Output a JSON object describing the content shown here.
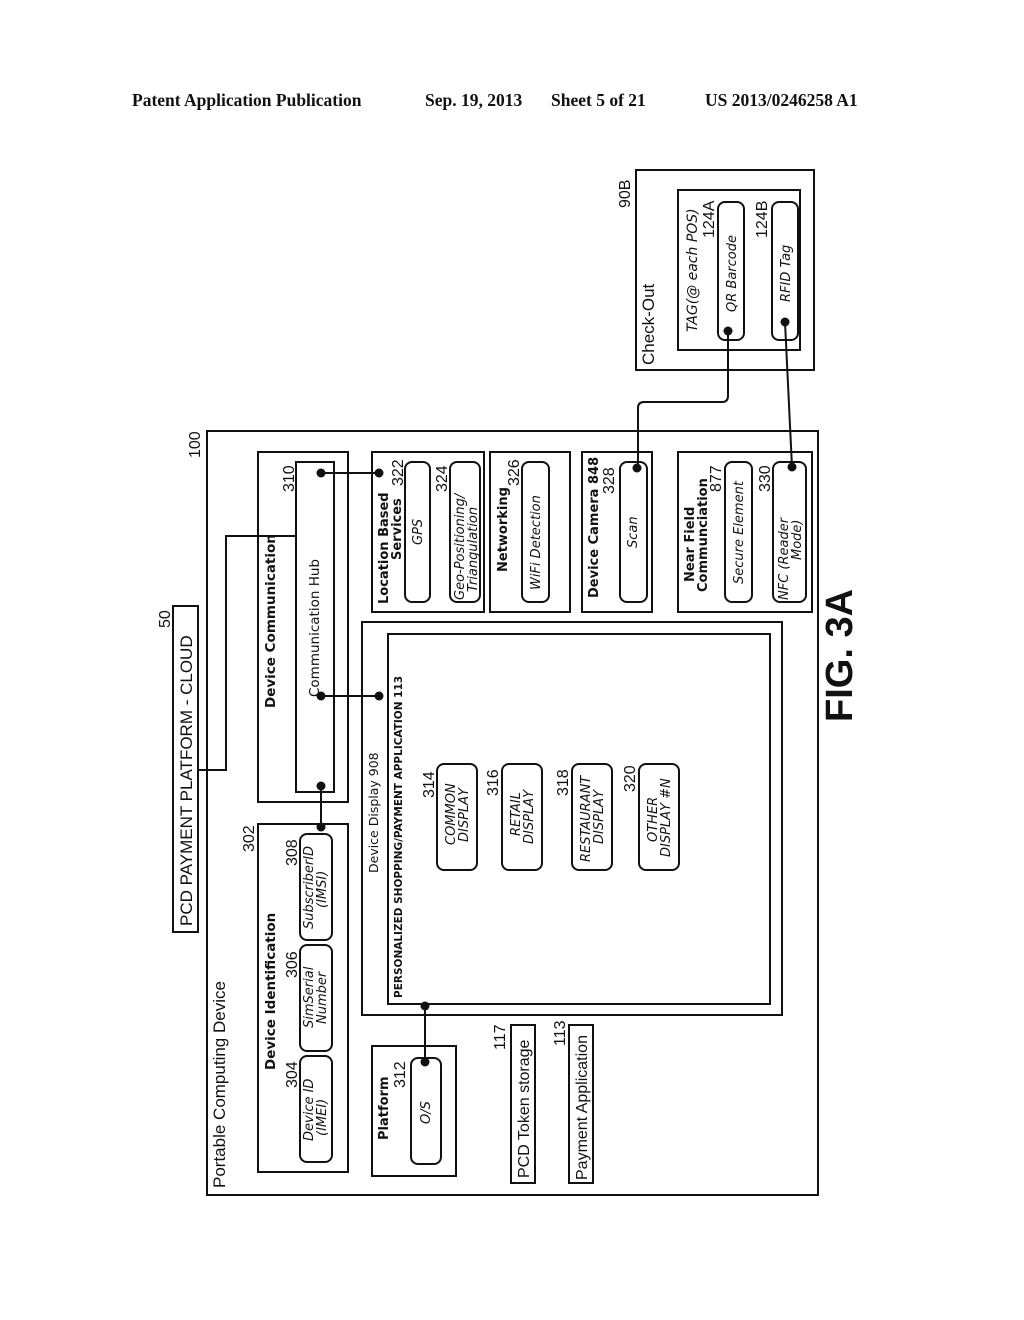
{
  "header": {
    "publication": "Patent Application Publication",
    "date": "Sep. 19, 2013",
    "sheet": "Sheet 5 of 21",
    "number": "US 2013/0246258 A1"
  },
  "figure_label": "FIG. 3A",
  "cloud": {
    "label": "PCD PAYMENT PLATFORM - CLOUD",
    "ref": "50"
  },
  "device": {
    "label": "Portable Computing Device",
    "ref": "100",
    "communication": {
      "label": "Device Communication",
      "hub": {
        "label": "Communication Hub",
        "ref": "310"
      }
    },
    "identification": {
      "label": "Device Identification",
      "ref": "302",
      "items": [
        {
          "line1": "Device ID",
          "line2": "(IMEI)",
          "ref": "304"
        },
        {
          "line1": "SimSerial",
          "line2": "Number",
          "ref": "306"
        },
        {
          "line1": "SubscriberID",
          "line2": "(IMSI)",
          "ref": "308"
        }
      ]
    },
    "display": {
      "label": "Device Display 908",
      "app_label": "PERSONALIZED SHOPPING/PAYMENT APPLICATION 113",
      "items": [
        {
          "line1": "COMMON",
          "line2": "DISPLAY",
          "ref": "314"
        },
        {
          "line1": "RETAIL",
          "line2": "DISPLAY",
          "ref": "316"
        },
        {
          "line1": "RESTAURANT",
          "line2": "DISPLAY",
          "ref": "318"
        },
        {
          "line1": "OTHER",
          "line2": "DISPLAY #N",
          "ref": "320"
        }
      ]
    },
    "location": {
      "label_line1": "Location Based",
      "label_line2": "Services",
      "gps": {
        "label": "GPS",
        "ref": "322"
      },
      "geo": {
        "line1": "Geo-Positioning/",
        "line2": "Triangulation",
        "ref": "324"
      }
    },
    "networking": {
      "label": "Networking",
      "item": "WiFi Detection",
      "ref": "326"
    },
    "camera": {
      "label": "Device Camera 848",
      "item": "Scan",
      "ref": "328"
    },
    "nfc": {
      "label_line1": "Near Field",
      "label_line2": "Communciation",
      "secure": {
        "label": "Secure Element",
        "ref": "877"
      },
      "reader": {
        "line1": "NFC (Reader",
        "line2": "Mode)",
        "ref": "330"
      }
    },
    "platform": {
      "label": "Platform",
      "item": "O/S",
      "ref": "312"
    },
    "token_storage": {
      "label": "PCD Token storage",
      "ref": "117"
    },
    "payment_app": {
      "label": "Payment Application",
      "ref": "113"
    }
  },
  "checkout": {
    "label": "Check-Out",
    "ref": "90B",
    "tag_label": "TAG(@ each POS)",
    "qr": {
      "label": "QR Barcode",
      "ref": "124A"
    },
    "rfid": {
      "label": "RFID Tag",
      "ref": "124B"
    }
  }
}
